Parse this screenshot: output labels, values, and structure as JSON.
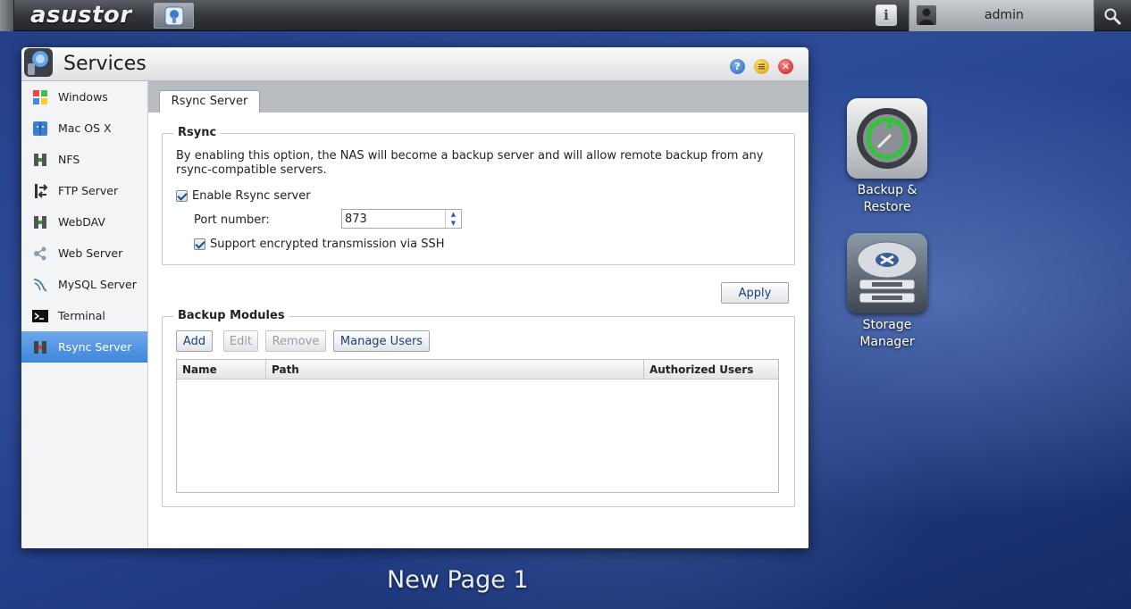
{
  "topbar": {
    "logo": "asustor",
    "user_name": "admin"
  },
  "window": {
    "title": "Services"
  },
  "sidebar": {
    "items": [
      {
        "label": "Windows",
        "icon": "windows-icon"
      },
      {
        "label": "Mac OS X",
        "icon": "mac-os-x-icon"
      },
      {
        "label": "NFS",
        "icon": "nfs-icon"
      },
      {
        "label": "FTP Server",
        "icon": "ftp-server-icon"
      },
      {
        "label": "WebDAV",
        "icon": "webdav-icon"
      },
      {
        "label": "Web Server",
        "icon": "web-server-icon"
      },
      {
        "label": "MySQL Server",
        "icon": "mysql-server-icon"
      },
      {
        "label": "Terminal",
        "icon": "terminal-icon"
      },
      {
        "label": "Rsync Server",
        "icon": "rsync-server-icon"
      }
    ],
    "active_index": 8
  },
  "tab": {
    "label": "Rsync Server"
  },
  "rsync": {
    "legend": "Rsync",
    "description": "By enabling this option, the NAS will become a backup server and will allow remote backup from any rsync-compatible servers.",
    "enable_label": "Enable Rsync server",
    "enable_checked": true,
    "port_label": "Port number:",
    "port_value": "873",
    "ssh_label": "Support encrypted transmission via SSH",
    "ssh_checked": true
  },
  "apply_label": "Apply",
  "modules": {
    "legend": "Backup Modules",
    "add_label": "Add",
    "edit_label": "Edit",
    "remove_label": "Remove",
    "manage_label": "Manage Users",
    "columns": [
      "Name",
      "Path",
      "Authorized Users"
    ],
    "rows": []
  },
  "desktop": {
    "backup_label_1": "Backup &",
    "backup_label_2": "Restore",
    "storage_label_1": "Storage",
    "storage_label_2": "Manager",
    "page_name": "New Page 1"
  }
}
